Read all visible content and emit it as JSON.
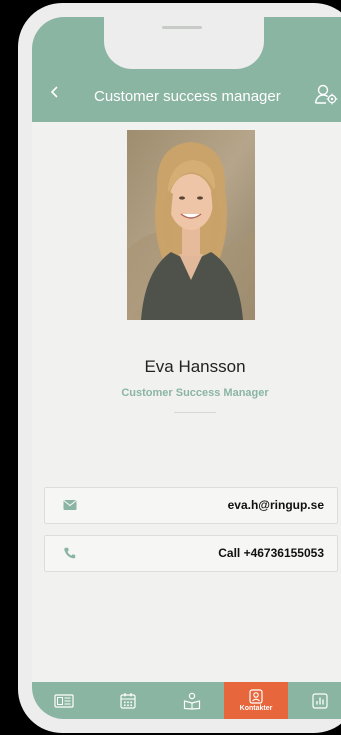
{
  "header": {
    "title": "Customer success manager",
    "back_icon": "chevron-left-icon",
    "settings_icon": "user-settings-icon"
  },
  "profile": {
    "name": "Eva Hansson",
    "role": "Customer Success Manager"
  },
  "contacts": [
    {
      "icon": "envelope-icon",
      "value": "eva.h@ringup.se"
    },
    {
      "icon": "phone-icon",
      "value": "Call +46736155053"
    }
  ],
  "tabbar": {
    "tabs": [
      {
        "icon": "news-icon",
        "label": ""
      },
      {
        "icon": "calendar-icon",
        "label": ""
      },
      {
        "icon": "book-reader-icon",
        "label": ""
      },
      {
        "icon": "contacts-icon",
        "label": "Kontakter",
        "active": true
      },
      {
        "icon": "stats-icon",
        "label": ""
      }
    ]
  },
  "colors": {
    "accent": "#8bb5a3",
    "active_tab": "#e8663b",
    "background": "#f1f1f0"
  }
}
